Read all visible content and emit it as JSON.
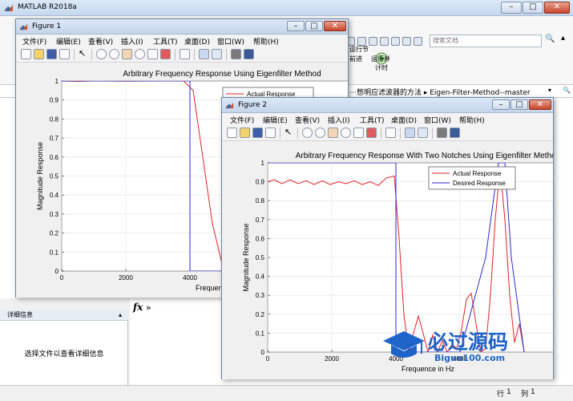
{
  "matlab": {
    "title": "MATLAB R2018a",
    "search_placeholder": "搜索文档",
    "ribbon_labels": [
      "运行节",
      "运行并",
      "计时",
      "前进"
    ],
    "path": "⋯憋明应滤波器的方法 ▸ Eigen-Filter-Method--master",
    "details_header": "详细信息",
    "details_text": "选择文件以查看详细信息",
    "cmd_prompt": "fx",
    "cmd_chevrons": "»",
    "status": {
      "row_label": "行",
      "row_value": "1",
      "col_label": "列",
      "col_value": "1"
    }
  },
  "figure1": {
    "title": "Figure 1",
    "menu": [
      "文件(F)",
      "编辑(E)",
      "查看(V)",
      "插入(I)",
      "工具(T)",
      "桌面(D)",
      "窗口(W)",
      "帮助(H)"
    ],
    "chart_data": {
      "type": "line",
      "title": "Arbitrary Frequency Response Using Eigenfilter Method",
      "xlabel": "Frequence in Hz",
      "ylabel": "Magnitude Response",
      "xlim": [
        0,
        10000
      ],
      "ylim": [
        0,
        1
      ],
      "xticks": [
        0,
        2000,
        4000,
        6000
      ],
      "yticks": [
        0,
        0.1,
        0.2,
        0.3,
        0.4,
        0.5,
        0.6,
        0.7,
        0.8,
        0.9,
        1
      ],
      "grid": true,
      "legend_position": "top-right",
      "series": [
        {
          "name": "Actual Response",
          "color": "#e8212a",
          "x": [
            0,
            500,
            1000,
            2000,
            3000,
            3800,
            4100,
            4400,
            4700,
            5000,
            5200,
            5400,
            5600,
            6000,
            6400,
            6800,
            7200,
            7400,
            7600
          ],
          "y": [
            1,
            0.998,
            1,
            0.999,
            1,
            1,
            0.95,
            0.6,
            0.25,
            0.04,
            0.01,
            0.02,
            0.01,
            0.015,
            0.01,
            0.015,
            0.01,
            0.05,
            0.09
          ]
        },
        {
          "name": "Desired Response",
          "color": "#2a2ad6",
          "x": [
            0,
            4000,
            4000,
            7100,
            7400,
            7600
          ],
          "y": [
            1,
            1,
            0,
            0,
            0.04,
            0.08
          ]
        }
      ]
    }
  },
  "figure2": {
    "title": "Figure 2",
    "menu": [
      "文件(F)",
      "编辑(E)",
      "查看(V)",
      "插入(I)",
      "工具(T)",
      "桌面(D)",
      "窗口(W)",
      "帮助(H)"
    ],
    "chart_data": {
      "type": "line",
      "title": "Arbitrary Frequency Response With Two Notches Using Eigenfilter Method",
      "xlabel": "Frequence in Hz",
      "ylabel": "Magnitude Response",
      "xlim": [
        0,
        10000
      ],
      "ylim": [
        0,
        1
      ],
      "xticks": [
        0,
        2000,
        4000,
        6000
      ],
      "yticks": [
        0,
        0.1,
        0.2,
        0.3,
        0.4,
        0.5,
        0.6,
        0.7,
        0.8,
        0.9,
        1
      ],
      "grid": true,
      "legend_position": "top-right",
      "series": [
        {
          "name": "Actual Response",
          "color": "#e8212a",
          "x": [
            0,
            200,
            450,
            700,
            950,
            1200,
            1450,
            1700,
            1950,
            2200,
            2450,
            2700,
            2950,
            3200,
            3450,
            3700,
            3950,
            4100,
            4250,
            4400,
            4550,
            4700,
            4850,
            5000,
            5150,
            5300,
            5450,
            5600,
            5750,
            5900,
            6050,
            6200,
            6350,
            6500,
            6650,
            6800,
            6950,
            7100,
            7250,
            7400,
            7550,
            7700,
            7850,
            8000
          ],
          "y": [
            0.9,
            0.91,
            0.89,
            0.91,
            0.89,
            0.905,
            0.885,
            0.905,
            0.885,
            0.9,
            0.89,
            0.905,
            0.885,
            0.9,
            0.88,
            0.92,
            0.93,
            0.6,
            0.2,
            0.0,
            0.1,
            0.19,
            0.1,
            0.0,
            0.09,
            0.0,
            0.06,
            0.0,
            0.04,
            0.02,
            0.12,
            0.28,
            0.31,
            0.15,
            0.0,
            0.02,
            0.3,
            0.7,
            0.98,
            0.7,
            0.3,
            0.05,
            0.15,
            0.0
          ]
        },
        {
          "name": "Desired Response",
          "color": "#2a2ad6",
          "x": [
            0,
            4000,
            4000,
            6000,
            6800,
            7200,
            7400,
            7600,
            8000
          ],
          "y": [
            1,
            1,
            0,
            0,
            0.5,
            1,
            1,
            0.5,
            0
          ]
        }
      ]
    }
  },
  "watermark": {
    "text": "必过源码",
    "url": "Biguo100.com"
  }
}
